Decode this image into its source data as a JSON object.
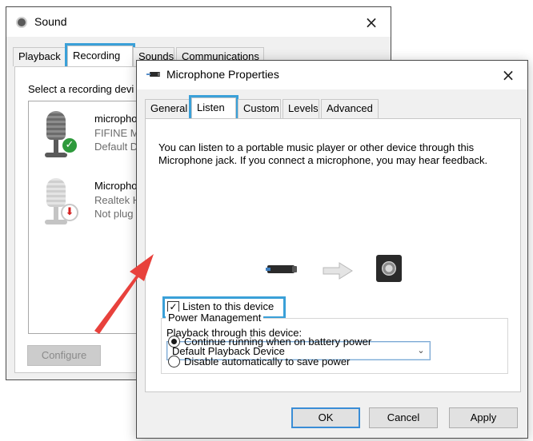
{
  "sound_window": {
    "title": "Sound",
    "tabs": [
      "Playback",
      "Recording",
      "Sounds",
      "Communications"
    ],
    "active_tab": "Recording",
    "instruction": "Select a recording devi",
    "devices": [
      {
        "name": "microphone",
        "line2": "FIFINE M",
        "line3": "Default D",
        "status": "default",
        "status_icon": "green-check-icon"
      },
      {
        "name": "Microphone",
        "line2": "Realtek H",
        "line3": "Not plug",
        "status": "unplugged",
        "status_icon": "red-down-arrow-icon"
      }
    ],
    "configure_label": "Configure"
  },
  "mic_window": {
    "title": "Microphone Properties",
    "tabs": [
      "General",
      "Listen",
      "Custom",
      "Levels",
      "Advanced"
    ],
    "active_tab": "Listen",
    "description": "You can listen to a portable music player or other device through this Microphone jack.  If you connect a microphone, you may hear feedback.",
    "listen_checkbox_label": "Listen to this device",
    "listen_checked": true,
    "playback_label": "Playback through this device:",
    "playback_value": "Default Playback Device",
    "power_group_title": "Power Management",
    "power_options": [
      {
        "label": "Continue running when on battery power",
        "selected": true
      },
      {
        "label": "Disable automatically to save power",
        "selected": false
      }
    ],
    "buttons": {
      "ok": "OK",
      "cancel": "Cancel",
      "apply": "Apply"
    }
  },
  "colors": {
    "highlight": "#3aa0d8",
    "annotation_arrow": "#e8413c",
    "ok_badge": "#2e9a3c"
  },
  "icons": {
    "close": "×",
    "check": "✓",
    "down": "⬇",
    "chevron": "⌄"
  }
}
